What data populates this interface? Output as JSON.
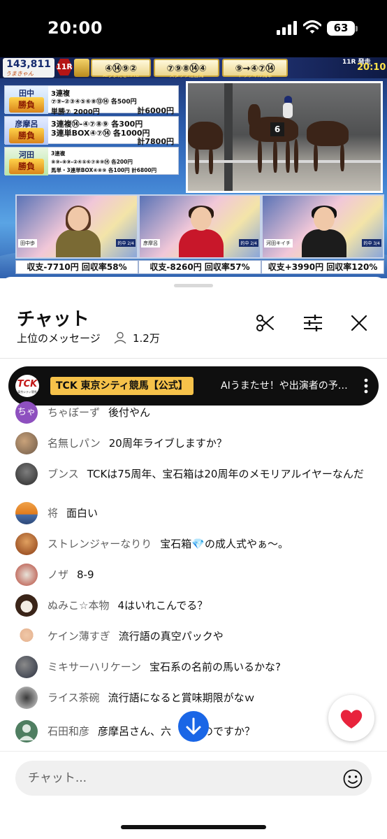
{
  "status_bar": {
    "time": "20:00",
    "battery": "63"
  },
  "video": {
    "viewer_count": "143,811",
    "viewer_sub": "うまきゃん",
    "race_badge": "11R",
    "picks": [
      {
        "nums": "④⑭⑨②",
        "caption": "AIうまたせ!!Pro"
      },
      {
        "nums": "⑦⑨⑧⑭④",
        "caption": "スタッフ注目馬"
      },
      {
        "nums": "⑨→④⑦⑭",
        "caption": "トリッキル馬単"
      }
    ],
    "race_time_label": "11R 発走",
    "race_clock": "20:10",
    "tipsters": [
      {
        "name": "田中",
        "logo": "勝負",
        "lines": [
          "3連複",
          "⑦⑨-②③④⑤⑥⑧⑬⑭ 各500円",
          "単勝⑦ 2000円"
        ],
        "total": "計6000円"
      },
      {
        "name": "彦摩呂",
        "logo": "勝負",
        "lines": [
          "3連複⑭-④⑦⑧⑨ 各300円",
          "3連単BOX④⑦⑭ 各1000円"
        ],
        "total": "計7800円"
      },
      {
        "name": "河田",
        "logo": "勝負",
        "lines": [
          "3連複",
          "⑧⑨-⑧⑨-②④⑤⑥⑦⑧⑨⑭ 各200円",
          "馬単・3連単BOX④⑧⑨ 各100円 計6800円"
        ],
        "total": ""
      }
    ],
    "cams": [
      {
        "plate": "田中歩",
        "tag": "的中 2/4",
        "stat": "収支-7710円 回収率58%"
      },
      {
        "plate": "彦摩呂",
        "tag": "的中 2/4",
        "stat": "収支-8260円 回収率57%"
      },
      {
        "plate": "河田キイチ",
        "tag": "的中 3/4",
        "stat": "収支+3990円 回収率120%"
      }
    ],
    "saddle_number": "6"
  },
  "chat": {
    "title": "チャット",
    "filter": "上位のメッセージ",
    "viewer_count": "1.2万",
    "pinned": {
      "logo": "TCK",
      "logo_sub": "東京シティ競馬",
      "channel": "TCK 東京シティ競馬【公式】",
      "message": "AIうまたせ！や出演者の予想はこちら"
    },
    "messages": [
      {
        "author": "ちゃぼーず",
        "text": "後付やん",
        "avatar": "ちゃ"
      },
      {
        "author": "名無しパン",
        "text": "20周年ライブしますか？",
        "avatar": ""
      },
      {
        "author": "ブンス",
        "text": "TCKは75周年、宝石箱は20周年のメモリアルイヤーなんだ",
        "avatar": ""
      },
      {
        "author": "将",
        "text": "面白い",
        "avatar": ""
      },
      {
        "author": "ストレンジャーなりり",
        "text": "宝石箱💎の成人式やぁ～。",
        "avatar": ""
      },
      {
        "author": "ノザ",
        "text": "8-9",
        "avatar": ""
      },
      {
        "author": "ぬみこ☆本物",
        "text": "4はいれこんでる？",
        "avatar": ""
      },
      {
        "author": "ケイン薄すぎ",
        "text": "流行語の真空パックや",
        "avatar": ""
      },
      {
        "author": "ミキサーハリケーン",
        "text": "宝石系の名前の馬いるかな?",
        "avatar": ""
      },
      {
        "author": "ライス茶碗",
        "text": "流行語になると賞味期限がなｗ",
        "avatar": ""
      },
      {
        "author": "石田和彦",
        "text": "彦摩呂さん、六　ないのですか？",
        "avatar": ""
      }
    ],
    "input_placeholder": "チャット...",
    "colors": {
      "accent": "#1a66e6",
      "pinned_chip": "#f6c24a",
      "pinned_bg": "#0f0f0f"
    }
  }
}
